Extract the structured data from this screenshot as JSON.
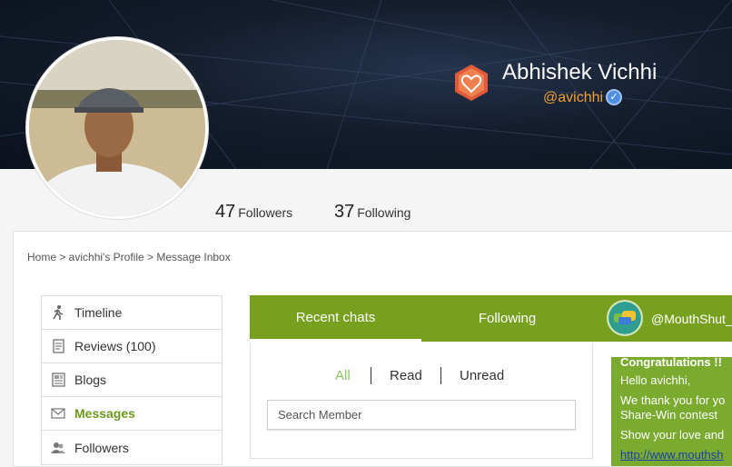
{
  "profile": {
    "name": "Abhishek Vichhi",
    "handle": "@avichhi",
    "verified_icon": "check-badge-icon",
    "badge_icon": "heart-hexagon-icon"
  },
  "stats": {
    "followers_count": "47",
    "followers_label": "Followers",
    "following_count": "37",
    "following_label": "Following"
  },
  "breadcrumb": "Home > avichhi's Profile > Message Inbox",
  "sidebar": {
    "items": [
      {
        "label": "Timeline",
        "icon": "walker-icon"
      },
      {
        "label": "Reviews (100)",
        "icon": "document-icon"
      },
      {
        "label": "Blogs",
        "icon": "blog-icon"
      },
      {
        "label": "Messages",
        "icon": "envelope-icon"
      },
      {
        "label": "Followers",
        "icon": "followers-icon"
      }
    ]
  },
  "chat": {
    "tabs": [
      "Recent chats",
      "Following"
    ],
    "contact": "@MouthShut_C",
    "filters": [
      "All",
      "Read",
      "Unread"
    ],
    "search_placeholder": "Search Member"
  },
  "message": {
    "lines": [
      "Congratulations !!",
      "Hello avichhi,",
      "We thank you for yo",
      "Share-Win contest",
      "Show your love and",
      "http://www.mouthsh"
    ]
  },
  "colors": {
    "accent": "#77a01f",
    "handle": "#f0a030",
    "active_menu": "#6c9a1a"
  }
}
